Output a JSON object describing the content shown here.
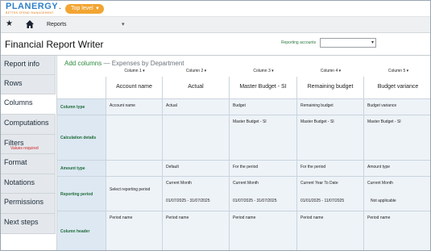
{
  "brand": {
    "logo": "PLANERGY",
    "tagline": "BETTER SPEND MANAGEMENT",
    "level_button": "Top level"
  },
  "nav": {
    "breadcrumb": "Reports"
  },
  "page": {
    "title": "Financial Report Writer",
    "reporting_accounts_label": "Reporting accounts",
    "reporting_accounts_value": ""
  },
  "sidebar": {
    "items": [
      {
        "label": "Report info",
        "sub": ""
      },
      {
        "label": "Rows",
        "sub": ""
      },
      {
        "label": "Columns",
        "sub": ""
      },
      {
        "label": "Computations",
        "sub": ""
      },
      {
        "label": "Filters",
        "sub": "Values required"
      },
      {
        "label": "Format",
        "sub": ""
      },
      {
        "label": "Notations",
        "sub": ""
      },
      {
        "label": "Permissions",
        "sub": ""
      },
      {
        "label": "Next steps",
        "sub": ""
      }
    ],
    "active_index": 2
  },
  "main": {
    "heading": "Add columns",
    "heading_sep": " — ",
    "heading_sub": "Expenses by Department",
    "columns": [
      {
        "header": "Column 1 ▾",
        "name": "Account name",
        "type": "Account name",
        "calc": "",
        "amount_type": "",
        "period": "Select reporting period",
        "period_range": "",
        "col_header": "Period name"
      },
      {
        "header": "Column 2 ▾",
        "name": "Actual",
        "type": "Actual",
        "calc": "",
        "amount_type": "Default",
        "period": "Current Month",
        "period_range": "01/07/2025 - 31/07/2025",
        "col_header": "Period name"
      },
      {
        "header": "Column 3 ▾",
        "name": "Master Budget - SI",
        "type": "Budget",
        "calc": "Master Budget - SI",
        "amount_type": "For the period",
        "period": "Current Month",
        "period_range": "01/07/2025 - 31/07/2025",
        "col_header": "Period name"
      },
      {
        "header": "Column 4 ▾",
        "name": "Remaining budget",
        "type": "Remaining budget",
        "calc": "Master Budget - SI",
        "amount_type": "For the period",
        "period": "Current Year To Date",
        "period_range": "01/01/2025 - 11/07/2025",
        "col_header": "Period name"
      },
      {
        "header": "Column 5 ▾",
        "name": "Budget variance",
        "type": "Budget variance",
        "calc": "Master Budget - SI",
        "amount_type": "Amount type",
        "period": "Current Month",
        "period_range": "Not applicable",
        "col_header": "Period name"
      }
    ],
    "row_labels": {
      "column_type": "Column type",
      "calculation_details": "Calculation details",
      "amount_type": "Amount type",
      "reporting_period": "Reporting period",
      "column_header": "Column header"
    }
  }
}
